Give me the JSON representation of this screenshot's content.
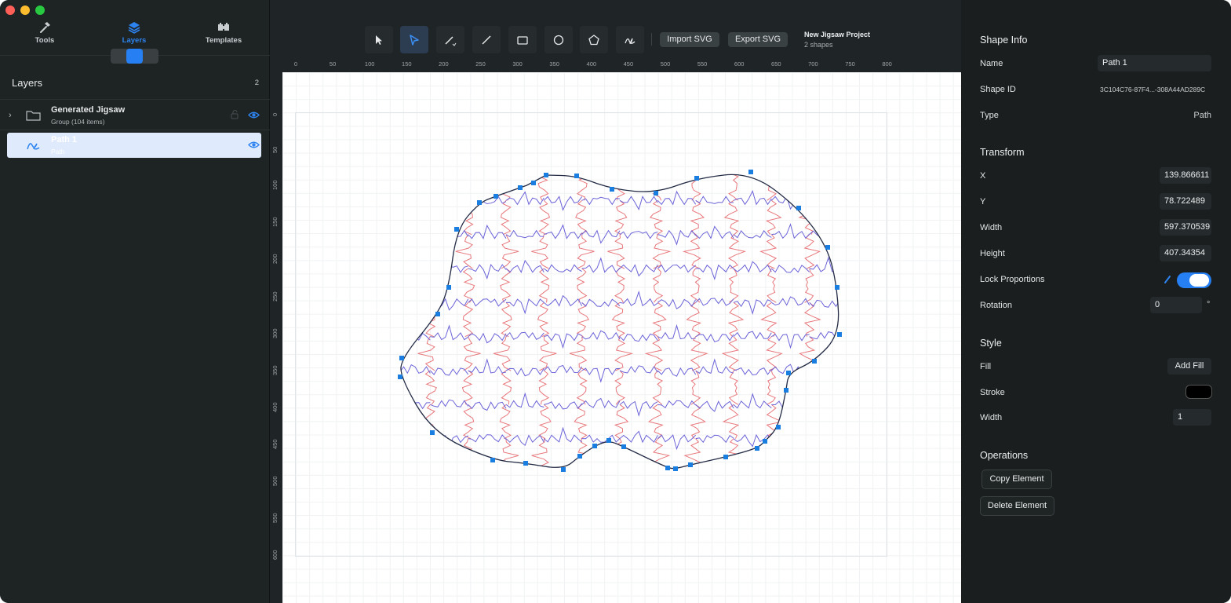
{
  "sidebar": {
    "tabs": [
      {
        "label": "Tools",
        "icon": "hammer-icon"
      },
      {
        "label": "Layers",
        "icon": "stack-icon"
      },
      {
        "label": "Templates",
        "icon": "puzzle-icon"
      }
    ],
    "layers_title": "Layers",
    "layers_count": "2",
    "layers": [
      {
        "title": "Generated Jigsaw",
        "subtitle": "Group   (104 items)"
      },
      {
        "title": "Path 1",
        "subtitle": "Path"
      }
    ]
  },
  "toolbar": {
    "tools": [
      "arrow-icon",
      "direct-select-icon",
      "pen-icon",
      "line-icon",
      "rectangle-icon",
      "ellipse-icon",
      "polygon-icon",
      "freehand-icon"
    ],
    "import_label": "Import SVG",
    "export_label": "Export SVG",
    "project_name": "New Jigsaw Project",
    "project_sub": "2 shapes"
  },
  "rulers": {
    "h": [
      "0",
      "50",
      "100",
      "150",
      "200",
      "250",
      "300",
      "350",
      "400",
      "450",
      "500",
      "550",
      "600",
      "650",
      "700",
      "750",
      "800"
    ],
    "v": [
      "0",
      "50",
      "100",
      "150",
      "200",
      "250",
      "300",
      "350",
      "400",
      "450",
      "500",
      "550",
      "600"
    ]
  },
  "inspector": {
    "shape_info_title": "Shape Info",
    "name_label": "Name",
    "name_value": "Path 1",
    "id_label": "Shape ID",
    "id_value": "3C104C76-87F4...-308A44AD289C",
    "type_label": "Type",
    "type_value": "Path",
    "transform_title": "Transform",
    "x_label": "X",
    "x_value": "139.866611",
    "y_label": "Y",
    "y_value": "78.722489",
    "width_label": "Width",
    "width_value": "597.370539",
    "height_label": "Height",
    "height_value": "407.34354",
    "lock_label": "Lock Proportions",
    "lock_on": true,
    "rotation_label": "Rotation",
    "rotation_value": "0",
    "rotation_unit": "°",
    "style_title": "Style",
    "fill_label": "Fill",
    "fill_button": "Add Fill",
    "stroke_label": "Stroke",
    "stroke_color": "#000000",
    "stroke_width_label": "Width",
    "stroke_width_value": "1",
    "operations_title": "Operations",
    "copy_label": "Copy Element",
    "delete_label": "Delete Element"
  },
  "colors": {
    "accent": "#2680f3",
    "jigsaw_red": "#e8777b",
    "jigsaw_blue": "#6b63d8",
    "outline": "#222a44",
    "handle": "#1a7de0"
  }
}
